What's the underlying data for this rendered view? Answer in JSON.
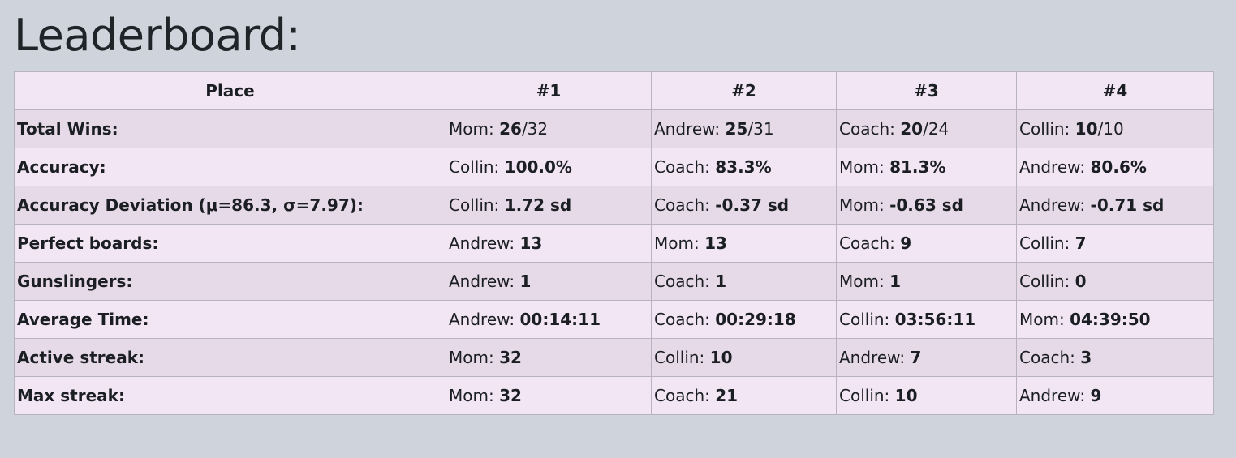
{
  "title": "Leaderboard:",
  "header": [
    "Place",
    "#1",
    "#2",
    "#3",
    "#4"
  ],
  "rows": [
    {
      "label": "Total Wins:",
      "cells": [
        {
          "name": "Mom",
          "value": "26",
          "suffix": "/32"
        },
        {
          "name": "Andrew",
          "value": "25",
          "suffix": "/31"
        },
        {
          "name": "Coach",
          "value": "20",
          "suffix": "/24"
        },
        {
          "name": "Collin",
          "value": "10",
          "suffix": "/10"
        }
      ]
    },
    {
      "label": "Accuracy:",
      "cells": [
        {
          "name": "Collin",
          "value": "100.0%",
          "suffix": ""
        },
        {
          "name": "Coach",
          "value": "83.3%",
          "suffix": ""
        },
        {
          "name": "Mom",
          "value": "81.3%",
          "suffix": ""
        },
        {
          "name": "Andrew",
          "value": "80.6%",
          "suffix": ""
        }
      ]
    },
    {
      "label": "Accuracy Deviation (μ=86.3, σ=7.97):",
      "cells": [
        {
          "name": "Collin",
          "value": "1.72 sd",
          "suffix": ""
        },
        {
          "name": "Coach",
          "value": "-0.37 sd",
          "suffix": ""
        },
        {
          "name": "Mom",
          "value": "-0.63 sd",
          "suffix": ""
        },
        {
          "name": "Andrew",
          "value": "-0.71 sd",
          "suffix": ""
        }
      ]
    },
    {
      "label": "Perfect boards:",
      "cells": [
        {
          "name": "Andrew",
          "value": "13",
          "suffix": ""
        },
        {
          "name": "Mom",
          "value": "13",
          "suffix": ""
        },
        {
          "name": "Coach",
          "value": "9",
          "suffix": ""
        },
        {
          "name": "Collin",
          "value": "7",
          "suffix": ""
        }
      ]
    },
    {
      "label": "Gunslingers:",
      "cells": [
        {
          "name": "Andrew",
          "value": "1",
          "suffix": ""
        },
        {
          "name": "Coach",
          "value": "1",
          "suffix": ""
        },
        {
          "name": "Mom",
          "value": "1",
          "suffix": ""
        },
        {
          "name": "Collin",
          "value": "0",
          "suffix": ""
        }
      ]
    },
    {
      "label": "Average Time:",
      "cells": [
        {
          "name": "Andrew",
          "value": "00:14:11",
          "suffix": ""
        },
        {
          "name": "Coach",
          "value": "00:29:18",
          "suffix": ""
        },
        {
          "name": "Collin",
          "value": "03:56:11",
          "suffix": ""
        },
        {
          "name": "Mom",
          "value": "04:39:50",
          "suffix": ""
        }
      ]
    },
    {
      "label": "Active streak:",
      "cells": [
        {
          "name": "Mom",
          "value": "32",
          "suffix": ""
        },
        {
          "name": "Collin",
          "value": "10",
          "suffix": ""
        },
        {
          "name": "Andrew",
          "value": "7",
          "suffix": ""
        },
        {
          "name": "Coach",
          "value": "3",
          "suffix": ""
        }
      ]
    },
    {
      "label": "Max streak:",
      "cells": [
        {
          "name": "Mom",
          "value": "32",
          "suffix": ""
        },
        {
          "name": "Coach",
          "value": "21",
          "suffix": ""
        },
        {
          "name": "Collin",
          "value": "10",
          "suffix": ""
        },
        {
          "name": "Andrew",
          "value": "9",
          "suffix": ""
        }
      ]
    }
  ]
}
